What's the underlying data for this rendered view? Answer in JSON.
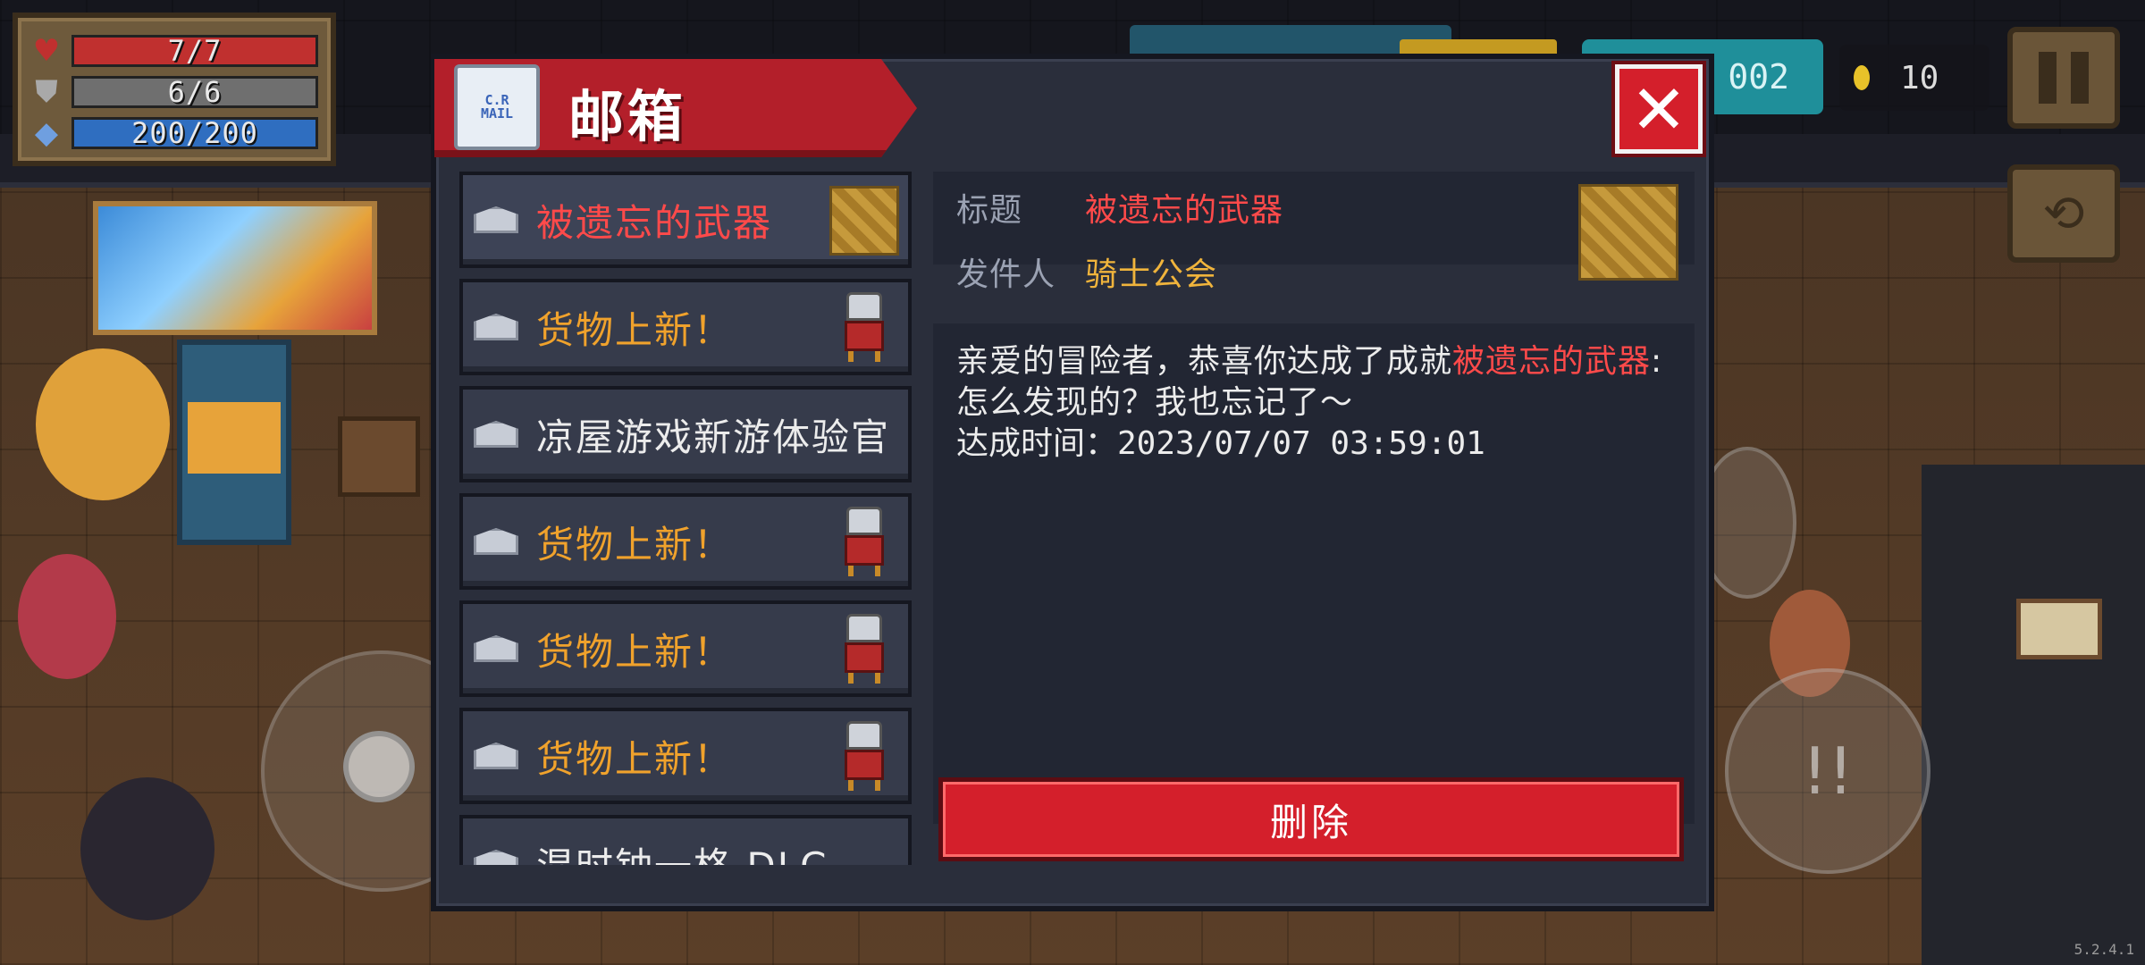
{
  "hud": {
    "hp": {
      "text": "7/7",
      "fill": 1.0,
      "color": "#c0302f",
      "icon": "heart-icon"
    },
    "armor": {
      "text": "6/6",
      "fill": 1.0,
      "color": "#6f6f6f",
      "icon": "shield-icon"
    },
    "energy": {
      "text": "200/200",
      "fill": 1.0,
      "color": "#2f6ec0",
      "icon": "diamond-icon"
    },
    "gems": "002",
    "coins": "10",
    "version": "5.2.4.1"
  },
  "mailbox": {
    "title": "邮箱",
    "icon_stamp_top": "C.R",
    "icon_stamp_bottom": "MAIL",
    "close_label": "✕",
    "mails": [
      {
        "subject": "被遗忘的武器",
        "color": "#ff4a4a",
        "thumb": "scroll",
        "selected": true
      },
      {
        "subject": "货物上新！",
        "color": "#f0a22c",
        "thumb": "character"
      },
      {
        "subject": "凉屋游戏新游体验官",
        "color": "#ececec",
        "thumb": "none"
      },
      {
        "subject": "货物上新！",
        "color": "#f0a22c",
        "thumb": "character"
      },
      {
        "subject": "货物上新！",
        "color": "#f0a22c",
        "thumb": "character"
      },
      {
        "subject": "货物上新！",
        "color": "#f0a22c",
        "thumb": "character"
      },
      {
        "subject": "混时钟一格 DLC",
        "color": "#ececec",
        "thumb": "none"
      }
    ],
    "detail": {
      "title_label": "标题",
      "title_value": "被遗忘的武器",
      "sender_label": "发件人",
      "sender_value": "骑士公会",
      "body_part1": "亲爱的冒险者，恭喜你达成了成就",
      "body_highlight": "被遗忘的武器",
      "body_part2": ":怎么发现的？我也忘记了～",
      "achieved_line": "达成时间：2023/07/07 03:59:01"
    },
    "delete_label": "删除"
  },
  "colors": {
    "accent_red": "#d41f2b",
    "highlight_red": "#ff4a4a",
    "orange": "#f0a22c",
    "gold": "#f0b43c"
  }
}
